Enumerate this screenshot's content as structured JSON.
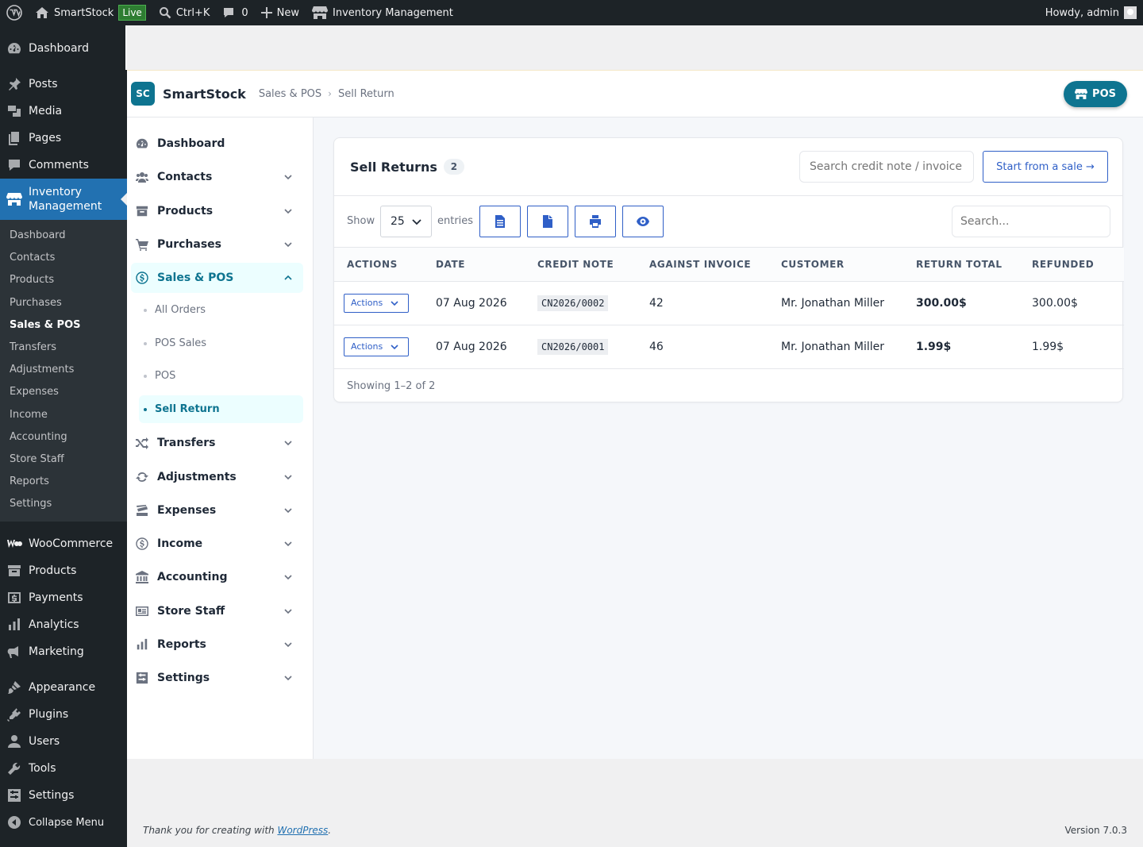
{
  "adminbar": {
    "site_name": "SmartStock",
    "live_badge": "Live",
    "shortcut": "Ctrl+K",
    "comments_count": "0",
    "new_label": "New",
    "plugin_label": "Inventory Management",
    "howdy": "Howdy, admin"
  },
  "wpmenu": {
    "dashboard": "Dashboard",
    "posts": "Posts",
    "media": "Media",
    "pages": "Pages",
    "comments": "Comments",
    "inventory": "Inventory Management",
    "sub": [
      "Dashboard",
      "Contacts",
      "Products",
      "Purchases",
      "Sales & POS",
      "Transfers",
      "Adjustments",
      "Expenses",
      "Income",
      "Accounting",
      "Store Staff",
      "Reports",
      "Settings"
    ],
    "woocommerce": "WooCommerce",
    "products": "Products",
    "payments": "Payments",
    "analytics": "Analytics",
    "marketing": "Marketing",
    "appearance": "Appearance",
    "plugins": "Plugins",
    "users": "Users",
    "tools": "Tools",
    "settings": "Settings",
    "collapse": "Collapse Menu"
  },
  "header": {
    "logo_initials": "SC",
    "brand": "SmartStock",
    "breadcrumb_parent": "Sales & POS",
    "breadcrumb_current": "Sell Return",
    "pos_button": "POS"
  },
  "sidebar": {
    "items": [
      "Dashboard",
      "Contacts",
      "Products",
      "Purchases",
      "Sales & POS",
      "Transfers",
      "Adjustments",
      "Expenses",
      "Income",
      "Accounting",
      "Store Staff",
      "Reports",
      "Settings"
    ],
    "sales_sub": [
      "All Orders",
      "POS Sales",
      "POS",
      "Sell Return"
    ]
  },
  "main": {
    "title": "Sell Returns",
    "count": "2",
    "search_credit_placeholder": "Search credit note / invoice",
    "start_button": "Start from a sale →",
    "show_label": "Show",
    "page_size": "25",
    "entries_label": "entries",
    "search_placeholder": "Search...",
    "columns": [
      "ACTIONS",
      "DATE",
      "CREDIT NOTE",
      "AGAINST INVOICE",
      "CUSTOMER",
      "RETURN TOTAL",
      "REFUNDED"
    ],
    "rows": [
      {
        "action": "Actions",
        "date": "07 Aug 2026",
        "credit_note": "CN2026/0002",
        "invoice": "42",
        "customer": "Mr. Jonathan Miller",
        "total": "300.00$",
        "refunded": "300.00$"
      },
      {
        "action": "Actions",
        "date": "07 Aug 2026",
        "credit_note": "CN2026/0001",
        "invoice": "46",
        "customer": "Mr. Jonathan Miller",
        "total": "1.99$",
        "refunded": "1.99$"
      }
    ],
    "showing": "Showing 1–2 of 2"
  },
  "footer": {
    "thanks_prefix": "Thank you for creating with ",
    "thanks_link": "WordPress",
    "thanks_suffix": ".",
    "version": "Version 7.0.3"
  }
}
